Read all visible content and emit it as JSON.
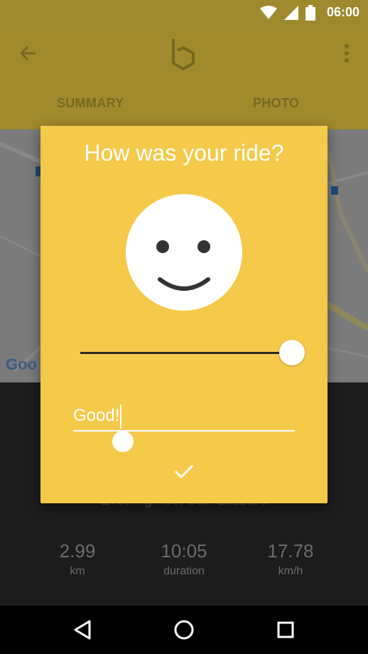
{
  "status_bar": {
    "time": "06:00"
  },
  "app_bar": {
    "tabs": [
      {
        "label": "SUMMARY"
      },
      {
        "label": "PHOTO"
      }
    ]
  },
  "map": {
    "attribution": "Goo"
  },
  "ride": {
    "title": "Evening ride, San Lazzaro",
    "stats": [
      {
        "value": "2.99",
        "label": "km"
      },
      {
        "value": "10:05",
        "label": "duration"
      },
      {
        "value": "17.78",
        "label": "km/h"
      }
    ]
  },
  "dialog": {
    "title": "How was your ride?",
    "rating_fraction": 1.0,
    "comment_value": "Good!"
  },
  "colors": {
    "dialog_background": "#f5c94a",
    "app_bar_dimmed": "#a08a2c",
    "text_on_dialog": "#ffffff"
  }
}
